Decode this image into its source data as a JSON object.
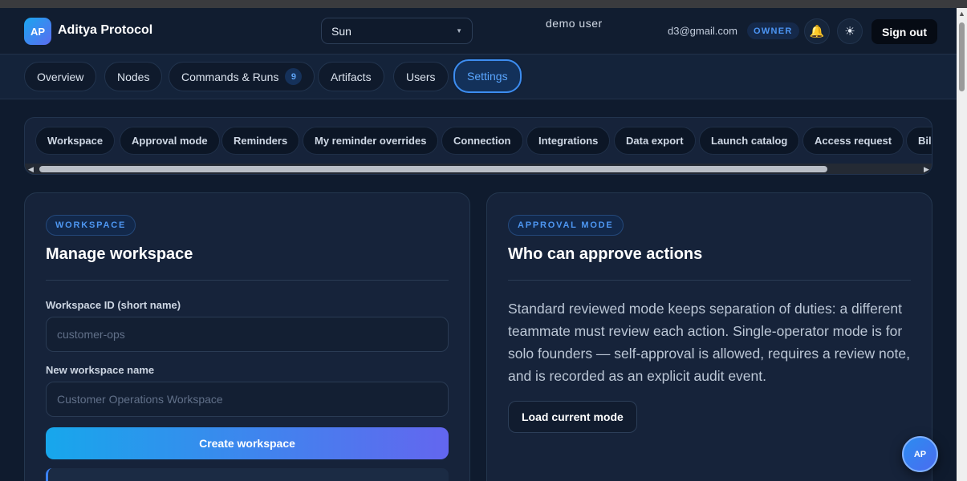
{
  "header": {
    "logo_initials": "AP",
    "app_title": "Aditya Protocol",
    "workspace_selected": "Sun",
    "user_label": "demo user",
    "email": "d3@gmail.com",
    "role_badge": "OWNER",
    "signout_label": "Sign out"
  },
  "nav": {
    "tabs": [
      {
        "label": "Overview"
      },
      {
        "label": "Nodes"
      },
      {
        "label": "Commands & Runs",
        "count": "9"
      },
      {
        "label": "Artifacts"
      },
      {
        "label": "Users"
      },
      {
        "label": "Settings",
        "active": true
      }
    ]
  },
  "settings_tabs": [
    {
      "label": "Workspace"
    },
    {
      "label": "Approval mode"
    },
    {
      "label": "Reminders"
    },
    {
      "label": "My reminder overrides"
    },
    {
      "label": "Connection"
    },
    {
      "label": "Integrations"
    },
    {
      "label": "Data export"
    },
    {
      "label": "Launch catalog"
    },
    {
      "label": "Access request"
    },
    {
      "label": "Billi"
    }
  ],
  "workspace_card": {
    "kicker": "WORKSPACE",
    "title": "Manage workspace",
    "id_label": "Workspace ID (short name)",
    "id_placeholder": "customer-ops",
    "name_label": "New workspace name",
    "name_placeholder": "Customer Operations Workspace",
    "create_label": "Create workspace"
  },
  "approval_card": {
    "kicker": "APPROVAL MODE",
    "title": "Who can approve actions",
    "description": "Standard reviewed mode keeps separation of duties: a different teammate must review each action. Single-operator mode is for solo founders — self-approval is allowed, requires a review note, and is recorded as an explicit audit event.",
    "load_label": "Load current mode"
  },
  "fab_initials": "AP",
  "colors": {
    "background": "#0f1b2e",
    "accent": "#3d8df0",
    "badge_text": "#4e97f2",
    "gradient_start": "#17a7ec",
    "gradient_end": "#6366ef"
  }
}
